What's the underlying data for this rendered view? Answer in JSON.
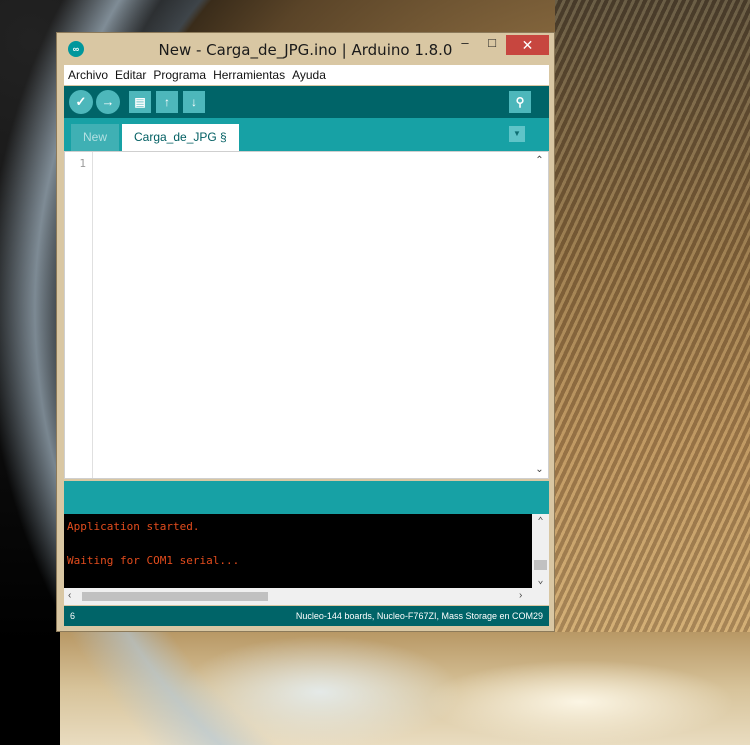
{
  "window": {
    "title": "New - Carga_de_JPG.ino | Arduino 1.8.0",
    "icon": "arduino-logo-icon",
    "controls": {
      "minimize": "–",
      "maximize": "□",
      "close": "✕"
    }
  },
  "menu": {
    "items": [
      "Archivo",
      "Editar",
      "Programa",
      "Herramientas",
      "Ayuda"
    ]
  },
  "toolbar": {
    "verify": "✓",
    "upload": "→",
    "new": "▤",
    "open": "↑",
    "save": "↓",
    "serial_monitor": "⚲"
  },
  "tabs": [
    {
      "label": "New",
      "active": false
    },
    {
      "label": "Carga_de_JPG §",
      "active": true
    }
  ],
  "editor": {
    "line_numbers": [
      "1"
    ],
    "content": ""
  },
  "console": {
    "lines": [
      "Application started.",
      "",
      "Waiting for COM1 serial..."
    ]
  },
  "status": {
    "line": "6",
    "board": "Nucleo-144 boards, Nucleo-F767ZI, Mass Storage en COM29"
  },
  "colors": {
    "toolbar_bg": "#006468",
    "tab_bar_bg": "#17a1a5",
    "console_text": "#e34c1d",
    "close_button": "#c7463f"
  }
}
